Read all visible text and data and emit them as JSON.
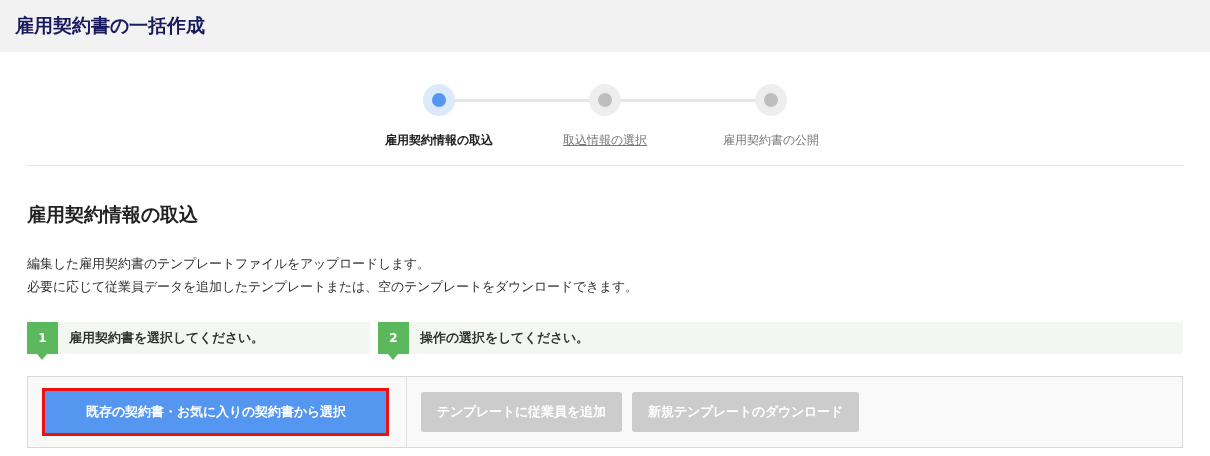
{
  "header": {
    "title": "雇用契約書の一括作成"
  },
  "stepper": [
    {
      "label": "雇用契約情報の取込",
      "selected": true,
      "link": false
    },
    {
      "label": "取込情報の選択",
      "selected": false,
      "link": true
    },
    {
      "label": "雇用契約書の公開",
      "selected": false,
      "link": false
    }
  ],
  "section": {
    "title": "雇用契約情報の取込",
    "description": [
      "編集した雇用契約書のテンプレートファイルをアップロードします。",
      "必要に応じて従業員データを追加したテンプレートまたは、空のテンプレートをダウンロードできます。"
    ]
  },
  "instructions": [
    {
      "number": "1",
      "text": "雇用契約書を選択してください。"
    },
    {
      "number": "2",
      "text": "操作の選択をしてください。"
    }
  ],
  "actions": {
    "primary": {
      "label": "既存の契約書・お気に入りの契約書から選択",
      "highlighted": true
    },
    "secondary": [
      {
        "label": "テンプレートに従業員を追加",
        "disabled": true
      },
      {
        "label": "新規テンプレートのダウンロード",
        "disabled": true
      }
    ]
  }
}
